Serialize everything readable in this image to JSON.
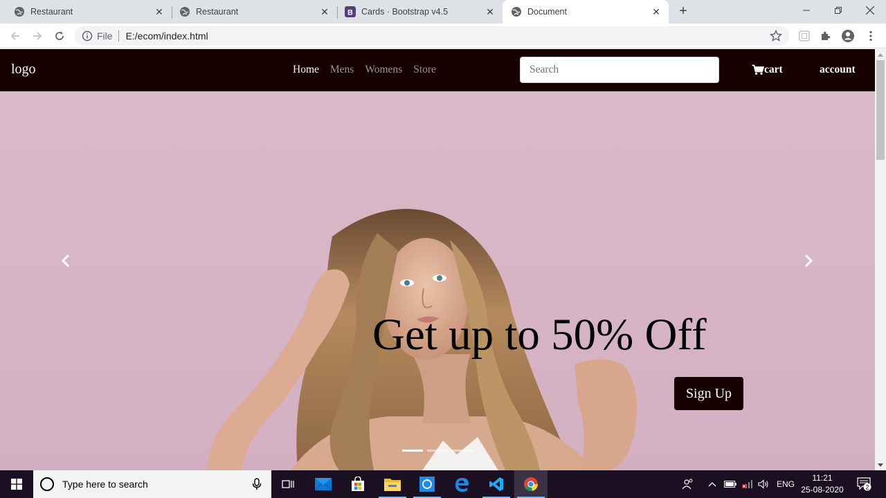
{
  "browser": {
    "tabs": [
      {
        "title": "Restaurant",
        "icon": "globe-icon",
        "active": false
      },
      {
        "title": "Restaurant",
        "icon": "globe-icon",
        "active": false
      },
      {
        "title": "Cards · Bootstrap v4.5",
        "icon": "bootstrap-icon",
        "active": false
      },
      {
        "title": "Document",
        "icon": "globe-icon",
        "active": true
      }
    ],
    "address": {
      "scheme": "File",
      "url": "E:/ecom/index.html"
    }
  },
  "site": {
    "logo": "logo",
    "nav": [
      {
        "label": "Home",
        "active": true
      },
      {
        "label": "Mens",
        "active": false
      },
      {
        "label": "Womens",
        "active": false
      },
      {
        "label": "Store",
        "active": false
      }
    ],
    "search_placeholder": "Search",
    "cart_label": "cart",
    "account_label": "account",
    "hero": {
      "headline": "Get up to 50% Off",
      "cta": "Sign Up",
      "slide_count": 3,
      "active_slide": 1
    },
    "colors": {
      "nav_bg": "#170000",
      "hero_bg": "#d9b8c8"
    }
  },
  "taskbar": {
    "search_placeholder": "Type here to search",
    "apps": [
      "task-view-icon",
      "mail-icon",
      "store-icon",
      "file-explorer-icon",
      "app-icon",
      "edge-icon",
      "vscode-icon",
      "chrome-icon"
    ],
    "language": "ENG",
    "time": "11:21",
    "date": "25-08-2020",
    "notification_count": "2"
  }
}
